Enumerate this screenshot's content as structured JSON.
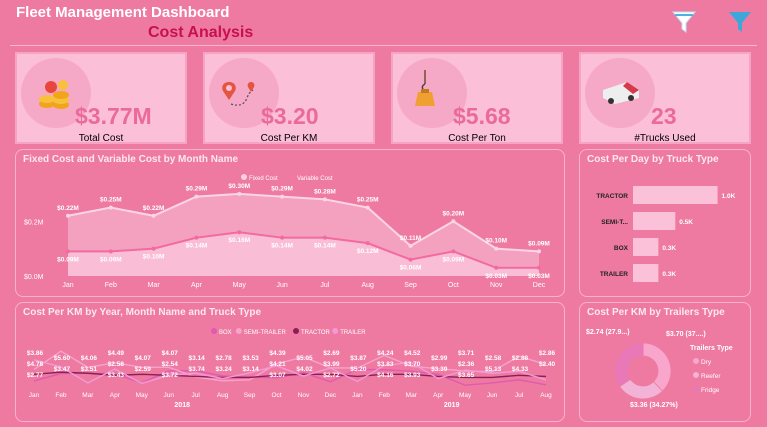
{
  "header": {
    "title": "Fleet Management Dashboard",
    "subtitle": "Cost Analysis",
    "filter_icons": [
      "funnel-icon",
      "funnel-icon"
    ]
  },
  "colors": {
    "background": "#ee7aa1",
    "card": "#fbbfd7",
    "accent": "#c8104f",
    "kpi_value": "#ea6a98"
  },
  "kpis": [
    {
      "value": "$3.77M",
      "label": "Total Cost",
      "icon": "coins-icon"
    },
    {
      "value": "$3.20",
      "label": "Cost Per KM",
      "icon": "route-pin-icon"
    },
    {
      "value": "$5.68",
      "label": "Cost Per Ton",
      "icon": "weight-hook-icon"
    },
    {
      "value": "23",
      "label": "#Trucks Used",
      "icon": "truck-icon"
    }
  ],
  "chart_data": [
    {
      "type": "area",
      "title": "Fixed Cost and Variable Cost by Month Name",
      "categories": [
        "Jan",
        "Feb",
        "Mar",
        "Apr",
        "May",
        "Jun",
        "Jul",
        "Aug",
        "Sep",
        "Oct",
        "Nov",
        "Dec"
      ],
      "series": [
        {
          "name": "Fixed Cost",
          "values": [
            0.22,
            0.25,
            0.22,
            0.29,
            0.3,
            0.29,
            0.28,
            0.25,
            0.11,
            0.2,
            0.1,
            0.09
          ],
          "labels": [
            "$0.22M",
            "$0.25M",
            "$0.22M",
            "$0.29M",
            "$0.30M",
            "$0.29M",
            "$0.28M",
            "$0.25M",
            "$0.11M",
            "$0.20M",
            "$0.10M",
            "$0.09M"
          ]
        },
        {
          "name": "Variable Cost",
          "values": [
            0.09,
            0.09,
            0.1,
            0.14,
            0.16,
            0.14,
            0.14,
            0.12,
            0.06,
            0.09,
            0.03,
            0.03
          ],
          "labels": [
            "$0.09M",
            "$0.09M",
            "$0.10M",
            "$0.14M",
            "$0.16M",
            "$0.14M",
            "$0.14M",
            "$0.12M",
            "$0.06M",
            "$0.09M",
            "$0.03M",
            "$0.03M"
          ]
        }
      ],
      "y_ticks": [
        "$0.0M",
        "$0.2M"
      ],
      "ylim": [
        0,
        0.38
      ],
      "legend_position": "top"
    },
    {
      "type": "bar",
      "orientation": "horizontal",
      "title": "Cost Per Day by Truck Type",
      "categories": [
        "TRACTOR",
        "SEMI-T...",
        "BOX",
        "TRAILER"
      ],
      "values": [
        1.0,
        0.5,
        0.3,
        0.3
      ],
      "labels": [
        "1.0K",
        "0.5K",
        "0.3K",
        "0.3K"
      ],
      "xlim": [
        0,
        1.1
      ]
    },
    {
      "type": "line",
      "title": "Cost Per KM by Year, Month Name and Truck Type",
      "legend": [
        "BOX",
        "SEMI-TRAILER",
        "TRACTOR",
        "TRAILER"
      ],
      "legend_position": "top",
      "categories": [
        "Jan",
        "Feb",
        "Mar",
        "Apr",
        "May",
        "Jun",
        "Jul",
        "Aug",
        "Sep",
        "Oct",
        "Nov",
        "Dec",
        "Jan",
        "Feb",
        "Mar",
        "Apr",
        "May",
        "Jun",
        "Jul",
        "Aug"
      ],
      "years": [
        "2018",
        "2019"
      ],
      "series": [
        {
          "name": "BOX",
          "values": [
            2.77,
            3.47,
            3.51,
            3.43,
            2.59,
            3.72,
            3.74,
            3.24,
            3.14,
            3.07,
            3.55,
            2.69,
            3.87,
            3.83,
            3.7,
            3.39,
            2.36,
            2.58,
            2.88,
            2.4
          ]
        },
        {
          "name": "SEMI-TRAILER",
          "values": [
            3.86,
            5.6,
            4.06,
            4.49,
            4.07,
            4.07,
            3.14,
            2.78,
            2.87,
            4.39,
            5.05,
            4.02,
            3.99,
            5.2,
            4.16,
            3.93,
            3.71,
            3.65,
            5.13,
            4.33
          ]
        },
        {
          "name": "TRACTOR",
          "values": [
            3.4,
            3.6,
            3.5,
            3.3,
            3.4,
            3.3,
            3.2,
            3.1,
            3.1,
            3.3,
            3.4,
            3.4,
            3.2,
            3.4,
            3.4,
            3.2,
            3.1,
            3.1,
            3.3,
            3.2
          ]
        },
        {
          "name": "TRAILER",
          "values": [
            4.78,
            4.1,
            2.58,
            3.9,
            2.54,
            3.3,
            3.5,
            3.0,
            3.53,
            4.21,
            3.23,
            4.0,
            2.72,
            4.24,
            4.52,
            2.99,
            3.8,
            3.5,
            3.7,
            2.86
          ]
        }
      ],
      "labels": [
        "$3.86",
        "$4.78",
        "$2.77",
        "$5.60",
        "$3.47",
        "$4.06",
        "$3.51",
        "$4.49",
        "$2.58",
        "$3.43",
        "$4.07",
        "$2.59",
        "$4.07",
        "$2.54",
        "$3.72",
        "$3.14",
        "$3.74",
        "$2.78",
        "$3.24",
        "$3.53",
        "$3.14",
        "$4.39",
        "$4.21",
        "$3.07",
        "$5.05",
        "$4.02",
        "$2.69",
        "$3.99",
        "$2.72",
        "$3.87",
        "$5.20",
        "$4.24",
        "$3.83",
        "$4.16",
        "$4.52",
        "$3.70",
        "$3.93",
        "$2.99",
        "$3.39",
        "$3.71",
        "$2.36",
        "$3.65",
        "$2.58",
        "$5.13",
        "$2.88",
        "$4.33",
        "$2.86",
        "$2.40"
      ],
      "ylim": [
        2,
        6
      ]
    },
    {
      "type": "pie",
      "title": "Cost Per KM by Trailers Type",
      "legend_title": "Trailers Type",
      "legend_position": "right",
      "categories": [
        "Dry",
        "Reefer",
        "Fridge"
      ],
      "values": [
        3.7,
        2.74,
        3.36
      ],
      "labels": [
        "$3.70 (37....)",
        "$2.74 (27.9...)",
        "$3.36 (34.27%)"
      ],
      "colors": [
        "#f8a6cb",
        "#f3b3d6",
        "#e878b8"
      ]
    }
  ]
}
